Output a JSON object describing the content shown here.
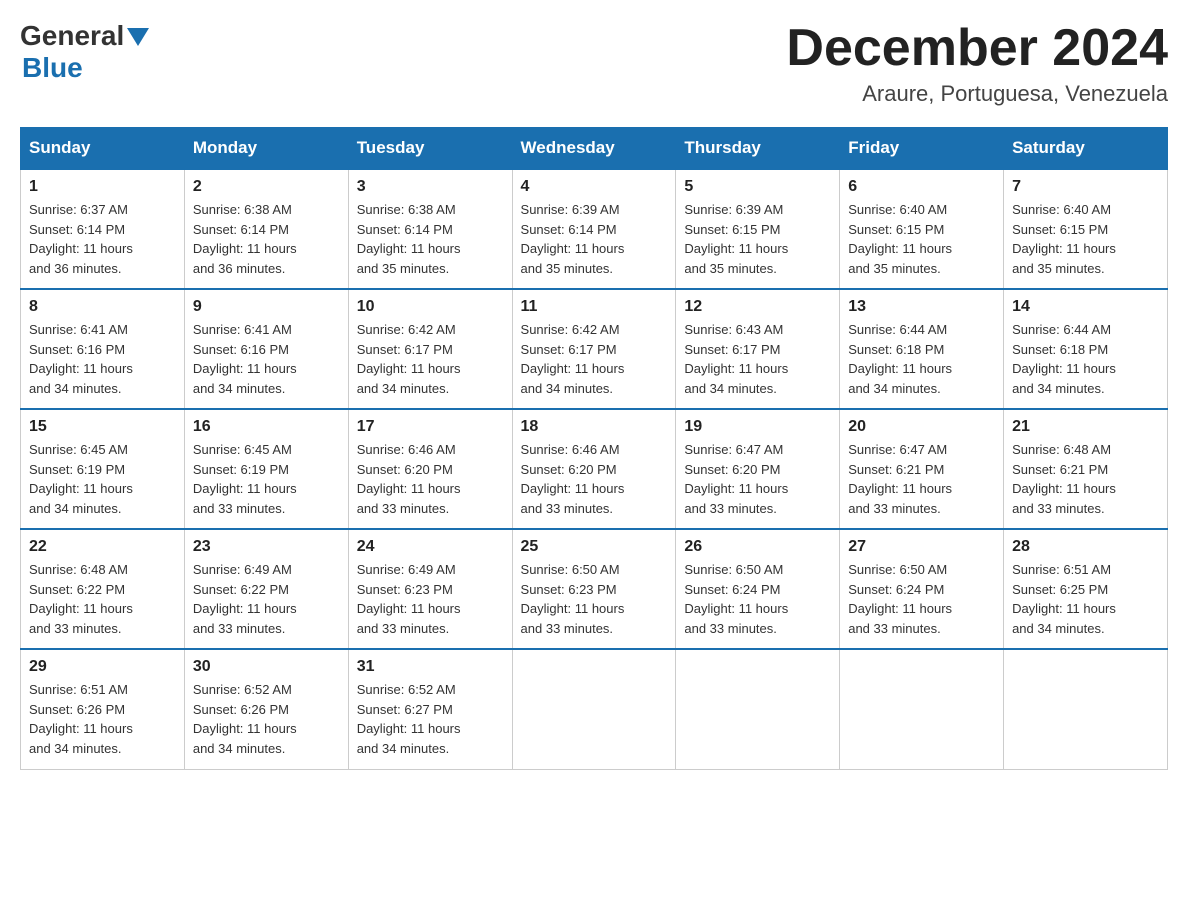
{
  "header": {
    "logo_general": "General",
    "logo_blue": "Blue",
    "month_title": "December 2024",
    "location": "Araure, Portuguesa, Venezuela"
  },
  "weekdays": [
    "Sunday",
    "Monday",
    "Tuesday",
    "Wednesday",
    "Thursday",
    "Friday",
    "Saturday"
  ],
  "weeks": [
    [
      {
        "day": "1",
        "sunrise": "6:37 AM",
        "sunset": "6:14 PM",
        "daylight": "11 hours and 36 minutes."
      },
      {
        "day": "2",
        "sunrise": "6:38 AM",
        "sunset": "6:14 PM",
        "daylight": "11 hours and 36 minutes."
      },
      {
        "day": "3",
        "sunrise": "6:38 AM",
        "sunset": "6:14 PM",
        "daylight": "11 hours and 35 minutes."
      },
      {
        "day": "4",
        "sunrise": "6:39 AM",
        "sunset": "6:14 PM",
        "daylight": "11 hours and 35 minutes."
      },
      {
        "day": "5",
        "sunrise": "6:39 AM",
        "sunset": "6:15 PM",
        "daylight": "11 hours and 35 minutes."
      },
      {
        "day": "6",
        "sunrise": "6:40 AM",
        "sunset": "6:15 PM",
        "daylight": "11 hours and 35 minutes."
      },
      {
        "day": "7",
        "sunrise": "6:40 AM",
        "sunset": "6:15 PM",
        "daylight": "11 hours and 35 minutes."
      }
    ],
    [
      {
        "day": "8",
        "sunrise": "6:41 AM",
        "sunset": "6:16 PM",
        "daylight": "11 hours and 34 minutes."
      },
      {
        "day": "9",
        "sunrise": "6:41 AM",
        "sunset": "6:16 PM",
        "daylight": "11 hours and 34 minutes."
      },
      {
        "day": "10",
        "sunrise": "6:42 AM",
        "sunset": "6:17 PM",
        "daylight": "11 hours and 34 minutes."
      },
      {
        "day": "11",
        "sunrise": "6:42 AM",
        "sunset": "6:17 PM",
        "daylight": "11 hours and 34 minutes."
      },
      {
        "day": "12",
        "sunrise": "6:43 AM",
        "sunset": "6:17 PM",
        "daylight": "11 hours and 34 minutes."
      },
      {
        "day": "13",
        "sunrise": "6:44 AM",
        "sunset": "6:18 PM",
        "daylight": "11 hours and 34 minutes."
      },
      {
        "day": "14",
        "sunrise": "6:44 AM",
        "sunset": "6:18 PM",
        "daylight": "11 hours and 34 minutes."
      }
    ],
    [
      {
        "day": "15",
        "sunrise": "6:45 AM",
        "sunset": "6:19 PM",
        "daylight": "11 hours and 34 minutes."
      },
      {
        "day": "16",
        "sunrise": "6:45 AM",
        "sunset": "6:19 PM",
        "daylight": "11 hours and 33 minutes."
      },
      {
        "day": "17",
        "sunrise": "6:46 AM",
        "sunset": "6:20 PM",
        "daylight": "11 hours and 33 minutes."
      },
      {
        "day": "18",
        "sunrise": "6:46 AM",
        "sunset": "6:20 PM",
        "daylight": "11 hours and 33 minutes."
      },
      {
        "day": "19",
        "sunrise": "6:47 AM",
        "sunset": "6:20 PM",
        "daylight": "11 hours and 33 minutes."
      },
      {
        "day": "20",
        "sunrise": "6:47 AM",
        "sunset": "6:21 PM",
        "daylight": "11 hours and 33 minutes."
      },
      {
        "day": "21",
        "sunrise": "6:48 AM",
        "sunset": "6:21 PM",
        "daylight": "11 hours and 33 minutes."
      }
    ],
    [
      {
        "day": "22",
        "sunrise": "6:48 AM",
        "sunset": "6:22 PM",
        "daylight": "11 hours and 33 minutes."
      },
      {
        "day": "23",
        "sunrise": "6:49 AM",
        "sunset": "6:22 PM",
        "daylight": "11 hours and 33 minutes."
      },
      {
        "day": "24",
        "sunrise": "6:49 AM",
        "sunset": "6:23 PM",
        "daylight": "11 hours and 33 minutes."
      },
      {
        "day": "25",
        "sunrise": "6:50 AM",
        "sunset": "6:23 PM",
        "daylight": "11 hours and 33 minutes."
      },
      {
        "day": "26",
        "sunrise": "6:50 AM",
        "sunset": "6:24 PM",
        "daylight": "11 hours and 33 minutes."
      },
      {
        "day": "27",
        "sunrise": "6:50 AM",
        "sunset": "6:24 PM",
        "daylight": "11 hours and 33 minutes."
      },
      {
        "day": "28",
        "sunrise": "6:51 AM",
        "sunset": "6:25 PM",
        "daylight": "11 hours and 34 minutes."
      }
    ],
    [
      {
        "day": "29",
        "sunrise": "6:51 AM",
        "sunset": "6:26 PM",
        "daylight": "11 hours and 34 minutes."
      },
      {
        "day": "30",
        "sunrise": "6:52 AM",
        "sunset": "6:26 PM",
        "daylight": "11 hours and 34 minutes."
      },
      {
        "day": "31",
        "sunrise": "6:52 AM",
        "sunset": "6:27 PM",
        "daylight": "11 hours and 34 minutes."
      },
      null,
      null,
      null,
      null
    ]
  ],
  "labels": {
    "sunrise": "Sunrise:",
    "sunset": "Sunset:",
    "daylight": "Daylight:"
  }
}
